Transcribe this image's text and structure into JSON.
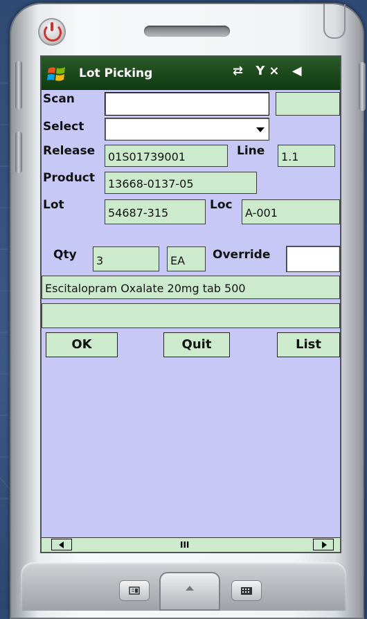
{
  "app": {
    "title": "Lot Picking",
    "status_icons_text": "⇄ Y× ◀",
    "accent_color": "#0f3a10",
    "screen_bg": "#c8c8f6",
    "field_bg": "#ccebcc"
  },
  "form": {
    "scan_label": "Scan",
    "scan_value": "",
    "select_label": "Select",
    "select_value": "",
    "release_label": "Release",
    "release_value": "01S01739001",
    "line_label": "Line",
    "line_value": "1.1",
    "product_label": "Product",
    "product_value": "13668-0137-05",
    "lot_label": "Lot",
    "lot_value": "54687-315",
    "loc_label": "Loc",
    "loc_value": "A-001",
    "qty_label": "Qty",
    "qty_value": "3",
    "uom_value": "EA",
    "override_label": "Override",
    "override_value": "",
    "description_value": "Escitalopram Oxalate 20mg tab 500",
    "message_value": ""
  },
  "buttons": {
    "ok_label": "OK",
    "quit_label": "Quit",
    "list_label": "List"
  },
  "scrollbar": {
    "thumb_glyph": "III"
  }
}
